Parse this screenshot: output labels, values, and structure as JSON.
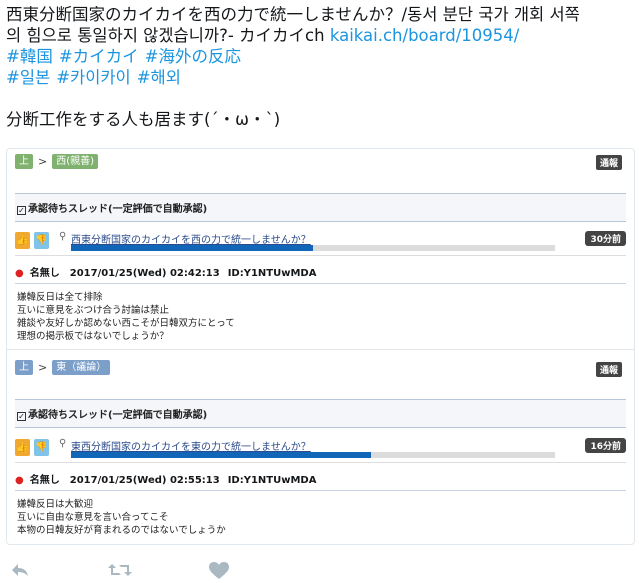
{
  "tweet": {
    "line1": "西東分断国家のカイカイを西の力で統一しませんか？/동서 분단 국가 개회 서쪽",
    "line2_prefix": "의 힘으로 통일하지 않겠습니까?- カイカイch ",
    "link": "kaikai.ch/board/10954/",
    "hashtags_row1": [
      "#韓国",
      "#カイカイ",
      "#海外の反応"
    ],
    "hashtags_row2": [
      "#일본",
      "#카이카이",
      "#해외"
    ],
    "comment": "分断工作をする人も居ます(´・ω・`)"
  },
  "board1": {
    "crumb_home": "上",
    "crumb_sep": ">",
    "crumb_board": "西(親善)",
    "report_label": "通報",
    "section_label": "承認待ちスレッド(一定評価で自動承認)",
    "thread_title": "西東分断国家のカイカイを西の力で統一しませんか？",
    "thread_progress": 0.5,
    "thread_time": "30分前",
    "post_name": "名無し",
    "post_date": "2017/01/25(Wed) 02:42:13",
    "post_id": "ID:Y1NTUwMDA",
    "post_lines": [
      "嫌韓反日は全て排除",
      "互いに意見をぶつけ合う討論は禁止",
      "雑談や友好しか認めない西こそが日韓双方にとって",
      "理想の掲示板ではないでしょうか？"
    ]
  },
  "board2": {
    "crumb_home": "上",
    "crumb_sep": ">",
    "crumb_board": "東（議論）",
    "report_label": "通報",
    "section_label": "承認待ちスレッド(一定評価で自動承認)",
    "thread_title": "東西分断国家のカイカイを東の力で統一しませんか？",
    "thread_progress": 0.62,
    "thread_time": "16分前",
    "post_name": "名無し",
    "post_date": "2017/01/25(Wed) 02:55:13",
    "post_id": "ID:Y1NTUwMDA",
    "post_lines": [
      "嫌韓反日は大歓迎",
      "互いに自由な意見を言い合ってこそ",
      "本物の日韓友好が育まれるのではないでしょうか"
    ]
  },
  "actions": {
    "icons": [
      "reply-icon",
      "retweet-icon",
      "like-icon"
    ]
  }
}
